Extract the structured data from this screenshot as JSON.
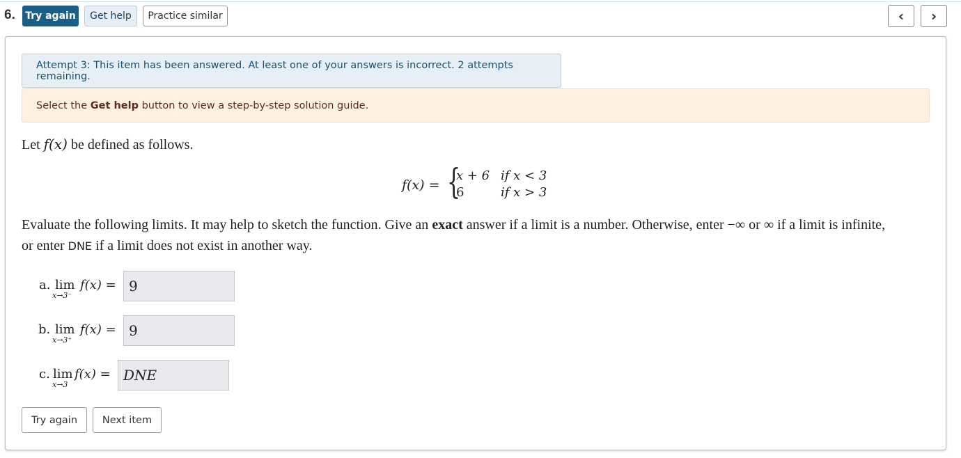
{
  "header": {
    "question_number": "6.",
    "try_again_label": "Try again",
    "get_help_label": "Get help",
    "practice_similar_label": "Practice similar",
    "prev_icon": "‹",
    "next_icon": "›"
  },
  "alerts": {
    "attempt_text": "Attempt 3: This item has been answered. At least one of your answers is incorrect. 2 attempts remaining.",
    "help_prefix": "Select the ",
    "help_bold": "Get help",
    "help_suffix": " button to view a step-by-step solution guide."
  },
  "problem": {
    "intro_prefix": "Let ",
    "intro_fx": "f(x)",
    "intro_suffix": " be defined as follows.",
    "def_lhs": "f(x) =",
    "case1_expr": "x + 6",
    "case1_cond": "if x < 3",
    "case2_expr": "6",
    "case2_cond": "if x > 3",
    "instr_line1_a": "Evaluate the following limits. It may help to sketch the function. Give an ",
    "instr_line1_bold": "exact",
    "instr_line1_b": " answer if a limit is a number. Otherwise, enter −∞ or ∞ if a limit is infinite,",
    "instr_line2_a": "or enter ",
    "instr_line2_code": "DNE",
    "instr_line2_b": " if a limit does not exist in another way."
  },
  "parts": [
    {
      "label": "a.",
      "lim": "lim",
      "sub": "x→3⁻",
      "expr": "f(x) =",
      "value": "9"
    },
    {
      "label": "b.",
      "lim": "lim",
      "sub": "x→3⁺",
      "expr": "f(x) =",
      "value": "9"
    },
    {
      "label": "c.",
      "lim": "lim",
      "sub": "x→3",
      "expr": "f(x) =",
      "value": "DNE"
    }
  ],
  "footer": {
    "try_again_label": "Try again",
    "next_item_label": "Next item"
  }
}
